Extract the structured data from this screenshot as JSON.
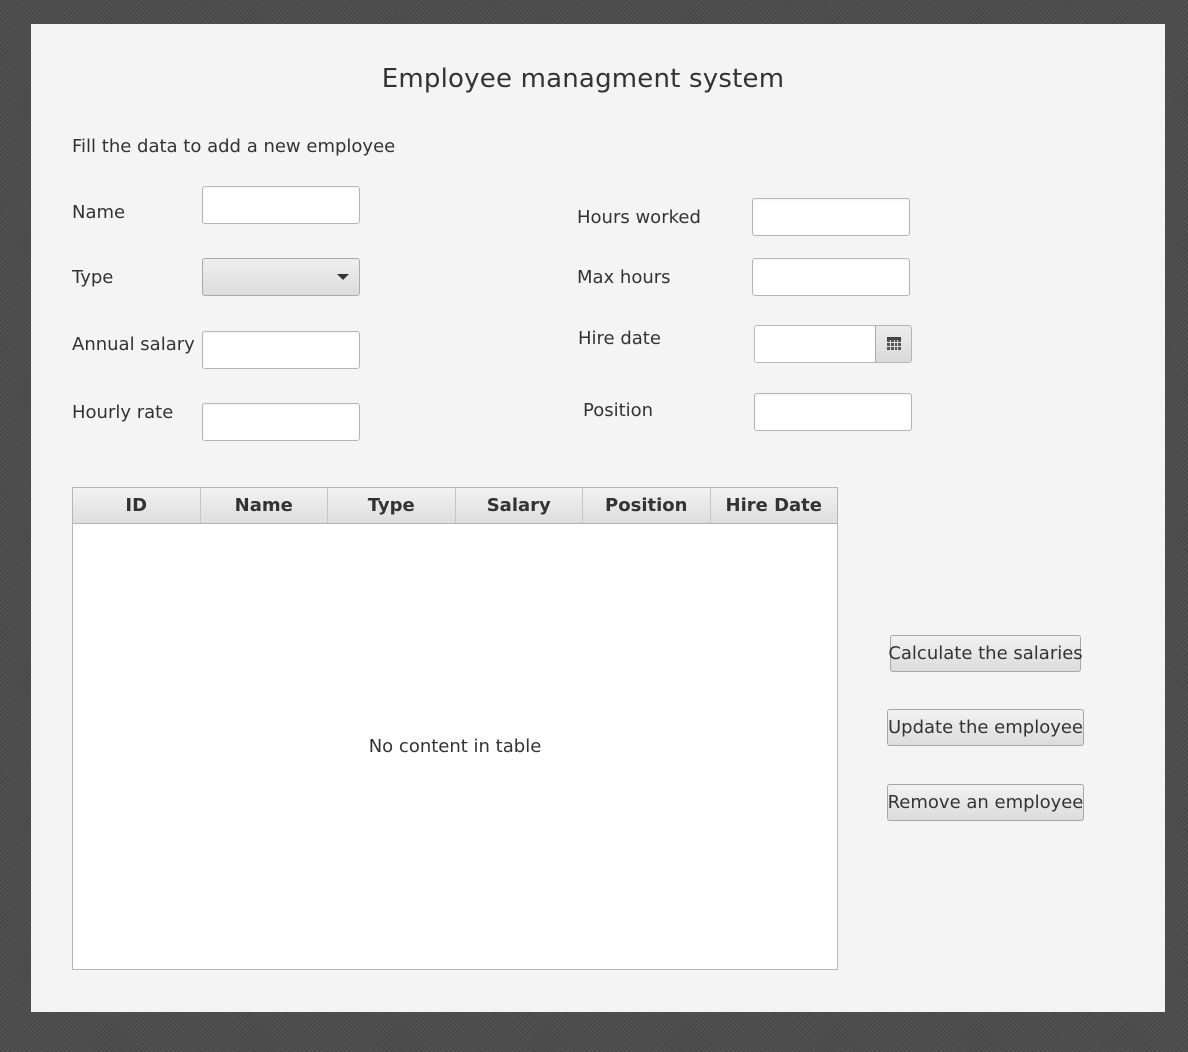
{
  "app": {
    "title": "Employee managment system",
    "subtitle": "Fill the data to add a new employee"
  },
  "form": {
    "left": {
      "name_label": "Name",
      "type_label": "Type",
      "annual_salary_label": "Annual salary",
      "hourly_rate_label": "Hourly rate",
      "name_value": "",
      "type_value": "",
      "annual_salary_value": "",
      "hourly_rate_value": ""
    },
    "right": {
      "hours_worked_label": "Hours worked",
      "max_hours_label": "Max hours",
      "hire_date_label": "Hire date",
      "position_label": "Position",
      "hours_worked_value": "",
      "max_hours_value": "",
      "hire_date_value": "",
      "position_value": ""
    }
  },
  "table": {
    "columns": [
      "ID",
      "Name",
      "Type",
      "Salary",
      "Position",
      "Hire Date"
    ],
    "rows": [],
    "empty_text": "No content in table"
  },
  "actions": {
    "calculate_label": "Calculate the salaries",
    "update_label": "Update the employee",
    "remove_label": "Remove an employee"
  },
  "icons": {
    "dropdown": "chevron-down-icon",
    "calendar": "calendar-icon"
  }
}
